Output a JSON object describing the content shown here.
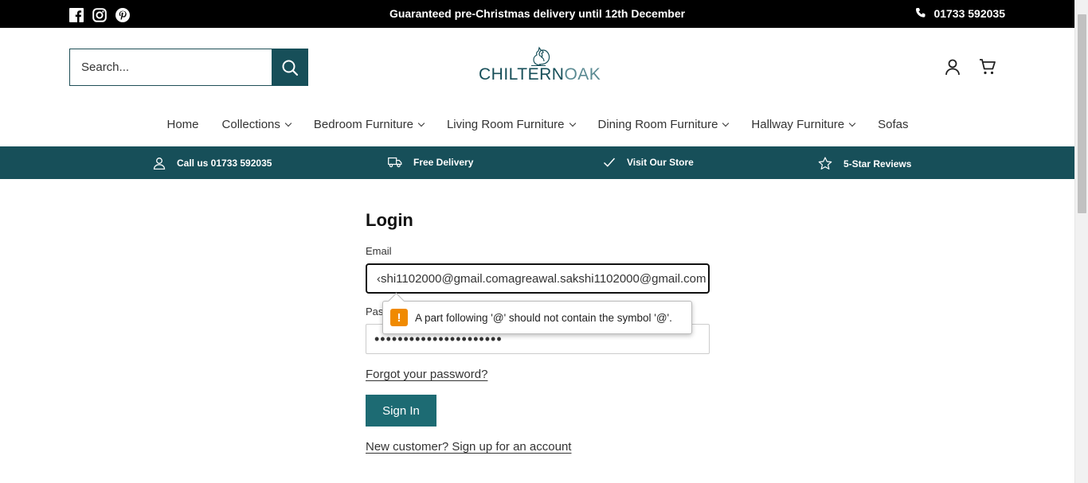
{
  "topbar": {
    "announcement": "Guaranteed pre-Christmas delivery until 12th December",
    "phone": "01733 592035",
    "social_icons": [
      "facebook-icon",
      "instagram-icon",
      "pinterest-icon"
    ]
  },
  "header": {
    "search_placeholder": "Search...",
    "logo_text_bold": "CHILTERN",
    "logo_text_light": "OAK",
    "icons": [
      "account-icon",
      "cart-icon"
    ]
  },
  "nav": {
    "items": [
      {
        "label": "Home",
        "has_dropdown": false
      },
      {
        "label": "Collections",
        "has_dropdown": true
      },
      {
        "label": "Bedroom Furniture",
        "has_dropdown": true
      },
      {
        "label": "Living Room Furniture",
        "has_dropdown": true
      },
      {
        "label": "Dining Room Furniture",
        "has_dropdown": true
      },
      {
        "label": "Hallway Furniture",
        "has_dropdown": true
      },
      {
        "label": "Sofas",
        "has_dropdown": false
      }
    ]
  },
  "usp": {
    "items": [
      {
        "icon": "person-icon",
        "label": "Call us 01733 592035"
      },
      {
        "icon": "truck-icon",
        "label": "Free Delivery"
      },
      {
        "icon": "check-icon",
        "label": "Visit Our Store"
      },
      {
        "icon": "star-icon",
        "label": "5-Star Reviews"
      }
    ]
  },
  "login": {
    "title": "Login",
    "email_label": "Email",
    "email_value": "‹shi1102000@gmail.comagreawal.sakshi1102000@gmail.com",
    "password_label": "Pas",
    "password_value": "••••••••••••••••••••••",
    "validation_message": "A part following '@' should not contain the symbol '@'.",
    "forgot_link": "Forgot your password?",
    "signin_label": "Sign In",
    "signup_link": "New customer? Sign up for an account"
  },
  "colors": {
    "brand_teal": "#174f59",
    "button_teal": "#1d6b73",
    "warning_orange": "#f08a00"
  }
}
